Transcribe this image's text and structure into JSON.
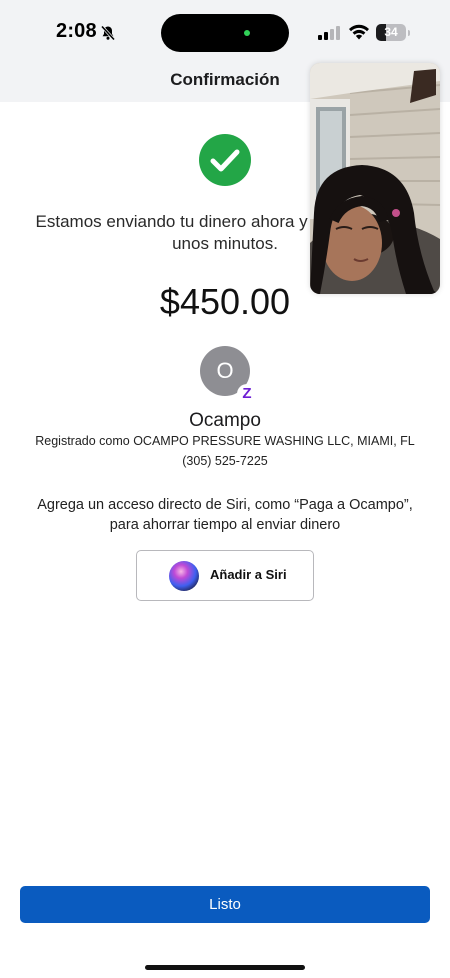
{
  "status_bar": {
    "time": "2:08",
    "battery": "34",
    "battery_level": 0.34
  },
  "header": {
    "title": "Confirmación"
  },
  "confirmation": {
    "message": "Estamos enviando tu dinero ahora y se recibirá en unos minutos.",
    "amount": "$450.00"
  },
  "recipient": {
    "initial": "O",
    "badge": "Z",
    "name": "Ocampo",
    "registered": "Registrado como OCAMPO PRESSURE WASHING LLC, MIAMI, FL",
    "phone": "(305) 525-7225"
  },
  "siri": {
    "hint": "Agrega un acceso directo de Siri, como “Paga a Ocampo”, para ahorrar tiempo al enviar dinero",
    "button_label": "Añadir a Siri"
  },
  "footer": {
    "done_label": "Listo"
  },
  "colors": {
    "accent": "#0a5bbf",
    "success": "#23a647",
    "zelle": "#6d1ed4"
  },
  "icons": [
    "bell-slash-icon",
    "signal-icon",
    "wifi-icon",
    "check-circle-icon",
    "siri-icon"
  ]
}
